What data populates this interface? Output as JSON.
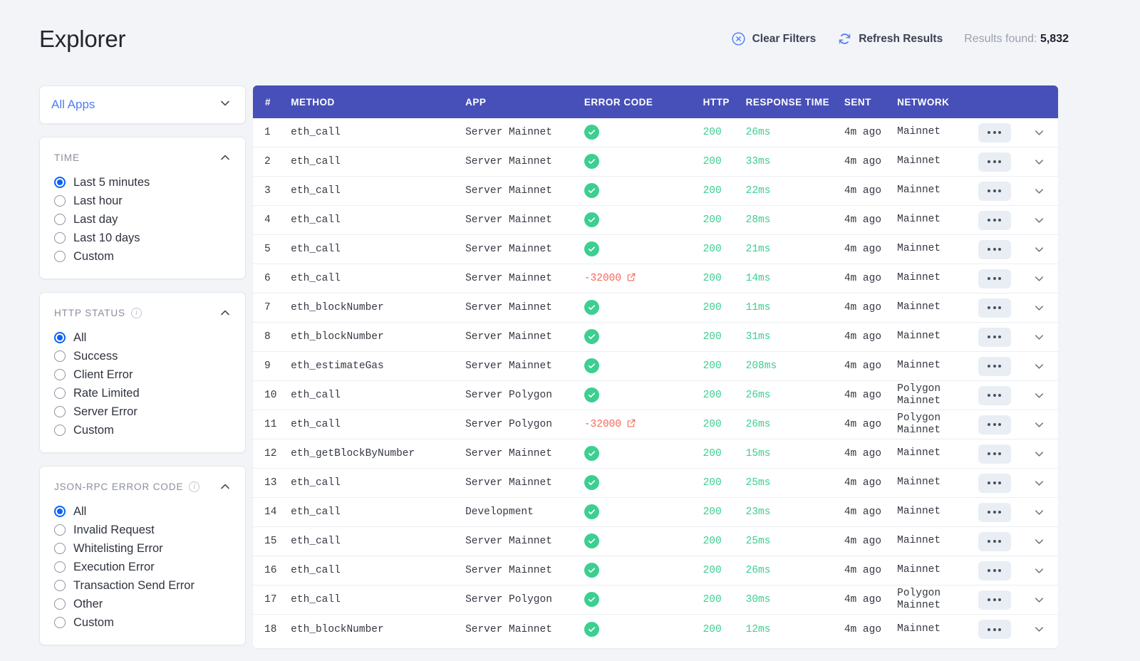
{
  "header": {
    "title": "Explorer",
    "clear_filters_label": "Clear Filters",
    "refresh_label": "Refresh Results",
    "results_prefix": "Results found:",
    "results_count": "5,832",
    "clear_icon": "circle-x-icon",
    "refresh_icon": "refresh-icon"
  },
  "sidebar": {
    "apps_select": {
      "value": "All Apps",
      "chevron": "chevron-down-icon"
    },
    "filters": [
      {
        "title": "TIME",
        "has_info": false,
        "collapse_icon": "chevron-up-icon",
        "options": [
          {
            "label": "Last 5 minutes",
            "checked": true
          },
          {
            "label": "Last hour",
            "checked": false
          },
          {
            "label": "Last day",
            "checked": false
          },
          {
            "label": "Last 10 days",
            "checked": false
          },
          {
            "label": "Custom",
            "checked": false
          }
        ]
      },
      {
        "title": "HTTP STATUS",
        "has_info": true,
        "collapse_icon": "chevron-up-icon",
        "options": [
          {
            "label": "All",
            "checked": true
          },
          {
            "label": "Success",
            "checked": false
          },
          {
            "label": "Client Error",
            "checked": false
          },
          {
            "label": "Rate Limited",
            "checked": false
          },
          {
            "label": "Server Error",
            "checked": false
          },
          {
            "label": "Custom",
            "checked": false
          }
        ]
      },
      {
        "title": "JSON-RPC ERROR CODE",
        "has_info": true,
        "collapse_icon": "chevron-up-icon",
        "options": [
          {
            "label": "All",
            "checked": true
          },
          {
            "label": "Invalid Request",
            "checked": false
          },
          {
            "label": "Whitelisting Error",
            "checked": false
          },
          {
            "label": "Execution Error",
            "checked": false
          },
          {
            "label": "Transaction Send Error",
            "checked": false
          },
          {
            "label": "Other",
            "checked": false
          },
          {
            "label": "Custom",
            "checked": false
          }
        ]
      }
    ]
  },
  "table": {
    "columns": [
      "#",
      "METHOD",
      "APP",
      "ERROR CODE",
      "HTTP",
      "RESPONSE TIME",
      "SENT",
      "NETWORK"
    ],
    "rows": [
      {
        "num": "1",
        "method": "eth_call",
        "app": "Server Mainnet",
        "error": "",
        "http": "200",
        "resp": "26ms",
        "sent": "4m ago",
        "network": "Mainnet"
      },
      {
        "num": "2",
        "method": "eth_call",
        "app": "Server Mainnet",
        "error": "",
        "http": "200",
        "resp": "33ms",
        "sent": "4m ago",
        "network": "Mainnet"
      },
      {
        "num": "3",
        "method": "eth_call",
        "app": "Server Mainnet",
        "error": "",
        "http": "200",
        "resp": "22ms",
        "sent": "4m ago",
        "network": "Mainnet"
      },
      {
        "num": "4",
        "method": "eth_call",
        "app": "Server Mainnet",
        "error": "",
        "http": "200",
        "resp": "28ms",
        "sent": "4m ago",
        "network": "Mainnet"
      },
      {
        "num": "5",
        "method": "eth_call",
        "app": "Server Mainnet",
        "error": "",
        "http": "200",
        "resp": "21ms",
        "sent": "4m ago",
        "network": "Mainnet"
      },
      {
        "num": "6",
        "method": "eth_call",
        "app": "Server Mainnet",
        "error": "-32000",
        "http": "200",
        "resp": "14ms",
        "sent": "4m ago",
        "network": "Mainnet"
      },
      {
        "num": "7",
        "method": "eth_blockNumber",
        "app": "Server Mainnet",
        "error": "",
        "http": "200",
        "resp": "11ms",
        "sent": "4m ago",
        "network": "Mainnet"
      },
      {
        "num": "8",
        "method": "eth_blockNumber",
        "app": "Server Mainnet",
        "error": "",
        "http": "200",
        "resp": "31ms",
        "sent": "4m ago",
        "network": "Mainnet"
      },
      {
        "num": "9",
        "method": "eth_estimateGas",
        "app": "Server Mainnet",
        "error": "",
        "http": "200",
        "resp": "208ms",
        "sent": "4m ago",
        "network": "Mainnet"
      },
      {
        "num": "10",
        "method": "eth_call",
        "app": "Server Polygon",
        "error": "",
        "http": "200",
        "resp": "26ms",
        "sent": "4m ago",
        "network": "Polygon\nMainnet"
      },
      {
        "num": "11",
        "method": "eth_call",
        "app": "Server Polygon",
        "error": "-32000",
        "http": "200",
        "resp": "26ms",
        "sent": "4m ago",
        "network": "Polygon\nMainnet"
      },
      {
        "num": "12",
        "method": "eth_getBlockByNumber",
        "app": "Server Mainnet",
        "error": "",
        "http": "200",
        "resp": "15ms",
        "sent": "4m ago",
        "network": "Mainnet"
      },
      {
        "num": "13",
        "method": "eth_call",
        "app": "Server Mainnet",
        "error": "",
        "http": "200",
        "resp": "25ms",
        "sent": "4m ago",
        "network": "Mainnet"
      },
      {
        "num": "14",
        "method": "eth_call",
        "app": "Development",
        "error": "",
        "http": "200",
        "resp": "23ms",
        "sent": "4m ago",
        "network": "Mainnet"
      },
      {
        "num": "15",
        "method": "eth_call",
        "app": "Server Mainnet",
        "error": "",
        "http": "200",
        "resp": "25ms",
        "sent": "4m ago",
        "network": "Mainnet"
      },
      {
        "num": "16",
        "method": "eth_call",
        "app": "Server Mainnet",
        "error": "",
        "http": "200",
        "resp": "26ms",
        "sent": "4m ago",
        "network": "Mainnet"
      },
      {
        "num": "17",
        "method": "eth_call",
        "app": "Server Polygon",
        "error": "",
        "http": "200",
        "resp": "30ms",
        "sent": "4m ago",
        "network": "Polygon\nMainnet"
      },
      {
        "num": "18",
        "method": "eth_blockNumber",
        "app": "Server Mainnet",
        "error": "",
        "http": "200",
        "resp": "12ms",
        "sent": "4m ago",
        "network": "Mainnet"
      }
    ],
    "row_icons": {
      "success": "check-circle-icon",
      "error_link": "external-link-icon",
      "actions": "ellipsis-icon",
      "expand": "chevron-down-icon"
    }
  },
  "colors": {
    "header_bar": "#4750b8",
    "success": "#3ccf91",
    "error": "#f4695c",
    "accent": "#4e7df0",
    "radio_checked": "#0b63f6"
  }
}
